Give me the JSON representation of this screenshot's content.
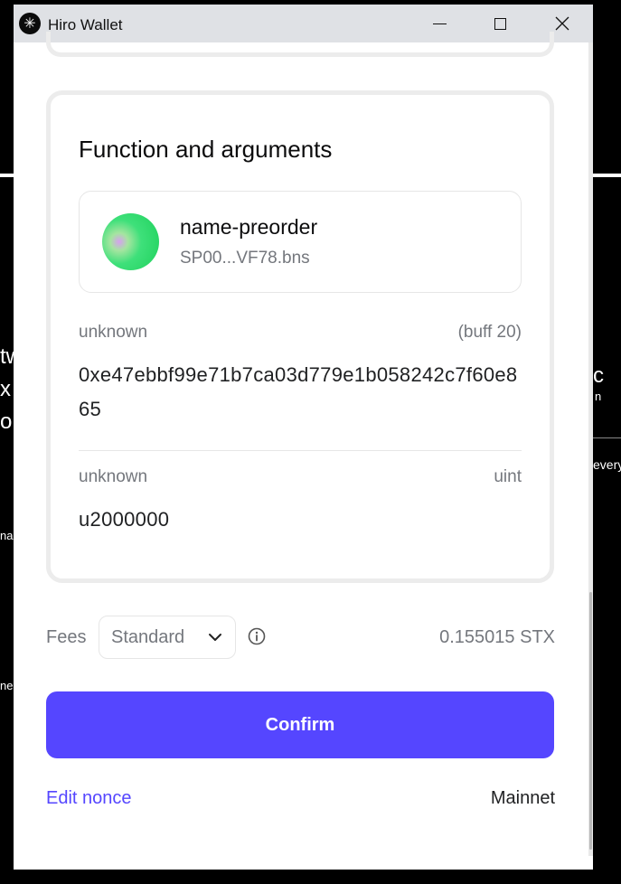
{
  "window": {
    "title": "Hiro Wallet",
    "logo_glyph": "✳"
  },
  "background": {
    "fragments": [
      "tw",
      "x",
      "ol",
      "na",
      "ne",
      "c",
      "n",
      "every"
    ]
  },
  "function_card": {
    "title": "Function and arguments",
    "function_name": "name-preorder",
    "contract": "SP00...VF78.bns",
    "arguments": [
      {
        "name": "unknown",
        "type": "(buff 20)",
        "value": "0xe47ebbf99e71b7ca03d779e1b058242c7f60e865"
      },
      {
        "name": "unknown",
        "type": "uint",
        "value": "u2000000"
      }
    ]
  },
  "fees": {
    "label": "Fees",
    "selected": "Standard",
    "amount": "0.155015 STX"
  },
  "actions": {
    "confirm_label": "Confirm",
    "edit_nonce_label": "Edit nonce",
    "network_label": "Mainnet"
  },
  "colors": {
    "accent": "#5546ff",
    "muted_text": "#74777d",
    "card_border": "#ececec"
  }
}
